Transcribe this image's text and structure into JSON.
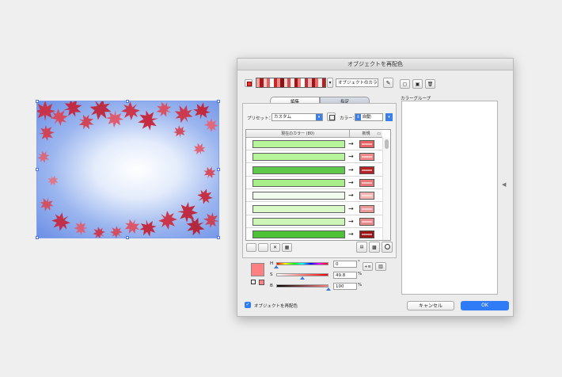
{
  "dialog": {
    "title": "オブジェクトを再配色",
    "harmony_name_placeholder": "オブジェクトのカラー",
    "tabs": [
      {
        "label": "編集",
        "selected": false
      },
      {
        "label": "指定",
        "selected": true
      }
    ],
    "preset_label": "プリセット：",
    "preset_value": "カスタム",
    "colors_label": "カラー：",
    "colors_value": "自動",
    "col_current": "現在のカラー (80)",
    "col_new": "新規",
    "rows": [
      {
        "current": "#b7f59a",
        "new": "#e65a5a",
        "new_color": "#e86464"
      },
      {
        "current": "#b7f59a",
        "new": "#f08c8c",
        "new_color": "#f08a8a"
      },
      {
        "current": "#5ec84a",
        "new": "#b52020",
        "new_color": "#b42323"
      },
      {
        "current": "#a8ee88",
        "new": "#ea7a7a",
        "new_color": "#e97878"
      },
      {
        "current": "#f2fcee",
        "new": "#f6b8b8",
        "new_color": "#f4b5b5"
      },
      {
        "current": "#d8f8c8",
        "new": "#ee9a9a",
        "new_color": "#ec9898"
      },
      {
        "current": "#cdf5b8",
        "new": "#ea8a8a",
        "new_color": "#e88888"
      },
      {
        "current": "#4cc234",
        "new": "#9d1515",
        "new_color": "#9a1717"
      }
    ],
    "hsb": {
      "h_label": "H",
      "h_value": "0",
      "h_unit": "°",
      "s_label": "S",
      "s_value": "49.8",
      "s_unit": "%",
      "b_label": "B",
      "b_value": "100",
      "b_unit": "%",
      "h_level": 0.0,
      "s_level": 0.498,
      "b_level": 1.0,
      "swatch_color": "#ff8080"
    },
    "recolor_checkbox_label": "オブジェクトを再配色",
    "recolor_checked": true,
    "color_group_label": "カラーグループ",
    "cancel_label": "キャンセル",
    "ok_label": "OK",
    "accent": "#2f7cf6"
  }
}
